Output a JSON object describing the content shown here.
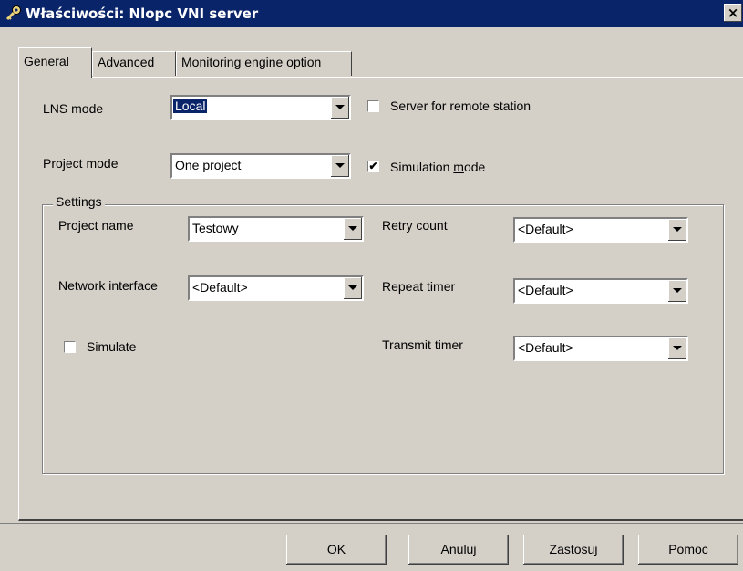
{
  "window": {
    "title": "Właściwości: Nlopc VNI server",
    "close_label": "×",
    "app_icon": "key-icon"
  },
  "tabs": [
    {
      "label": "General",
      "active": true
    },
    {
      "label": "Advanced",
      "active": false
    },
    {
      "label": "Monitoring engine option",
      "active": false
    }
  ],
  "general": {
    "lns_mode": {
      "label": "LNS mode",
      "value": "Local"
    },
    "server_remote": {
      "label": "Server for remote station",
      "checked": false
    },
    "project_mode": {
      "label": "Project mode",
      "value": "One project"
    },
    "simulation_mode": {
      "label": "Simulation mode",
      "mnemonic_pre": "Simulation ",
      "mnemonic_char": "m",
      "mnemonic_post": "ode",
      "checked": true,
      "check_glyph": "✔"
    },
    "settings": {
      "title": "Settings",
      "project_name": {
        "label": "Project name",
        "value": "Testowy"
      },
      "network_interface": {
        "label": "Network interface",
        "value": "<Default>"
      },
      "simulate": {
        "label": "Simulate",
        "checked": false
      },
      "retry_count": {
        "label": "Retry count",
        "value": "<Default>"
      },
      "repeat_timer": {
        "label": "Repeat timer",
        "value": "<Default>"
      },
      "transmit_timer": {
        "label": "Transmit timer",
        "value": "<Default>"
      }
    }
  },
  "buttons": {
    "ok": "OK",
    "cancel": "Anuluj",
    "apply_pre": "",
    "apply_char": "Z",
    "apply_post": "astosuj",
    "help": "Pomoc"
  }
}
